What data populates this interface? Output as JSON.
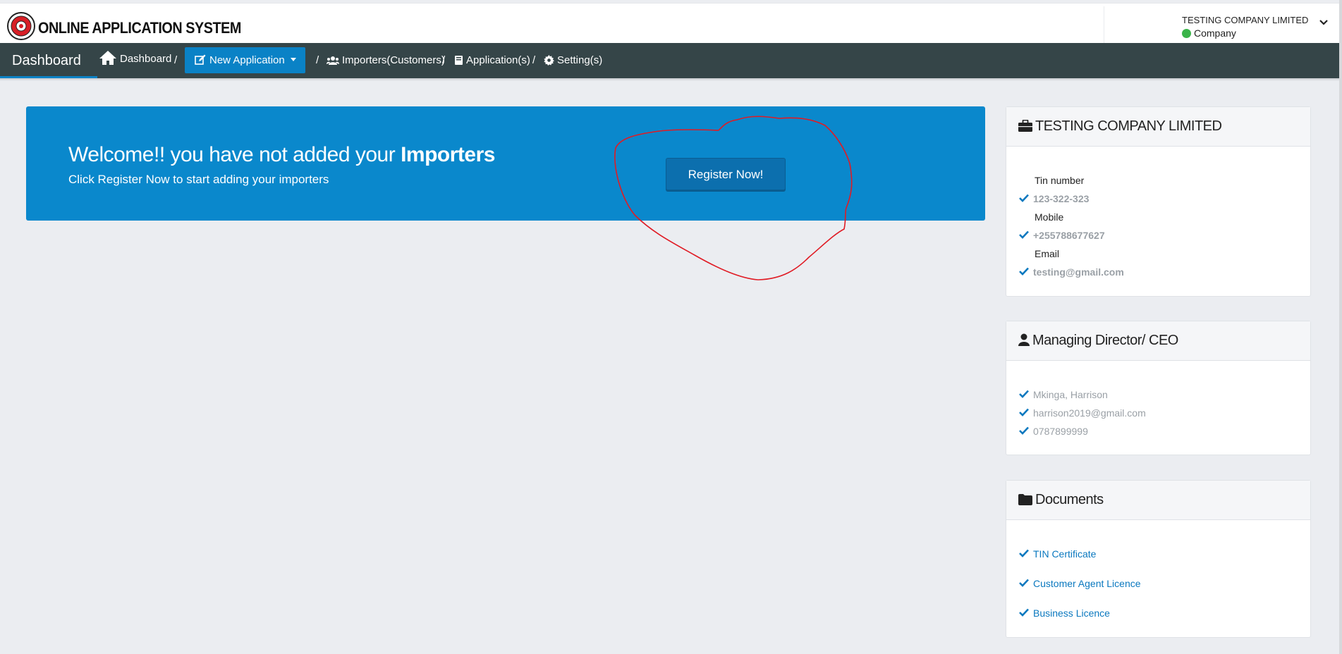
{
  "header": {
    "app_title": "ONLINE APPLICATION SYSTEM",
    "user_name": "TESTING COMPANY LIMITED",
    "user_role": "Company"
  },
  "nav": {
    "brand": "Dashboard",
    "dashboard": "Dashboard",
    "new_application": "New Application",
    "importers": "Importers(Customers)",
    "applications": "Application(s)",
    "settings": "Setting(s)",
    "separator": "/"
  },
  "banner": {
    "welcome_prefix": "Welcome!! you have not added your ",
    "welcome_bold": "Importers",
    "subtext": "Click Register Now to start adding your importers",
    "register_button": "Register Now!"
  },
  "company_card": {
    "title": "TESTING COMPANY LIMITED",
    "tin_label": "Tin number",
    "tin_value": "123-322-323",
    "mobile_label": "Mobile",
    "mobile_value": "+255788677627",
    "email_label": "Email",
    "email_value": "testing@gmail.com"
  },
  "director_card": {
    "title": "Managing Director/ CEO",
    "name": "Mkinga, Harrison",
    "email": "harrison2019@gmail.com",
    "phone": "0787899999"
  },
  "documents_card": {
    "title": "Documents",
    "items": [
      "TIN Certificate",
      "Customer Agent Licence",
      "Business Licence"
    ]
  },
  "colors": {
    "navbar": "#354548",
    "accent": "#0a82c6",
    "banner": "#0a88cc",
    "annotation": "#e01b24"
  }
}
